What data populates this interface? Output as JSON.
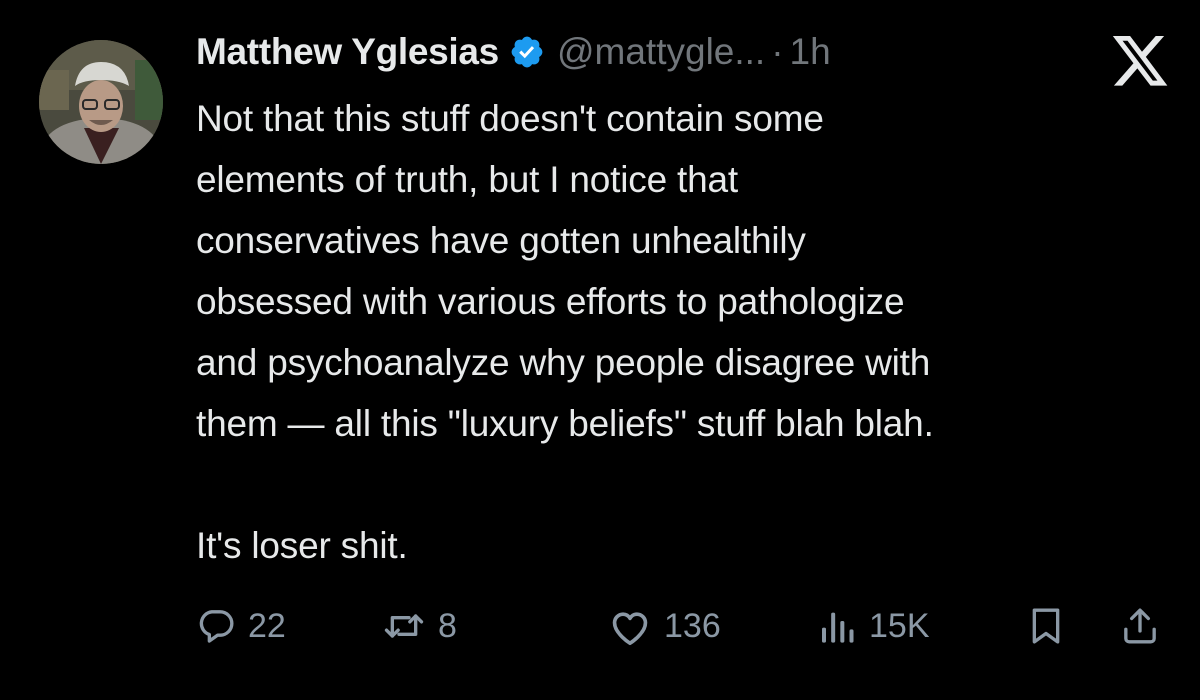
{
  "author": {
    "display_name": "Matthew Yglesias",
    "handle": "@mattygle...",
    "separator": "·",
    "timestamp": "1h",
    "verified_icon": "verified-badge-icon",
    "avatar_icon": "profile-photo"
  },
  "platform": {
    "logo_icon": "x-logo-icon"
  },
  "tweet": {
    "paragraph_1": "Not that this stuff doesn't contain some\nelements of truth, but I notice that\nconservatives have gotten unhealthily\nobsessed with various efforts to pathologize\nand psychoanalyze why people disagree with\nthem — all this \"luxury beliefs\" stuff blah blah.",
    "paragraph_2": "It's loser shit."
  },
  "actions": {
    "replies": "22",
    "reposts": "8",
    "likes": "136",
    "views": "15K",
    "reply_icon": "reply-icon",
    "repost_icon": "repost-icon",
    "like_icon": "heart-icon",
    "views_icon": "views-icon",
    "bookmark_icon": "bookmark-icon",
    "share_icon": "share-icon"
  },
  "colors": {
    "background": "#000000",
    "text": "#e7e9ea",
    "secondary_text": "#71767b",
    "action_gray": "#8b98a5",
    "verified_blue": "#1d9bf0"
  }
}
